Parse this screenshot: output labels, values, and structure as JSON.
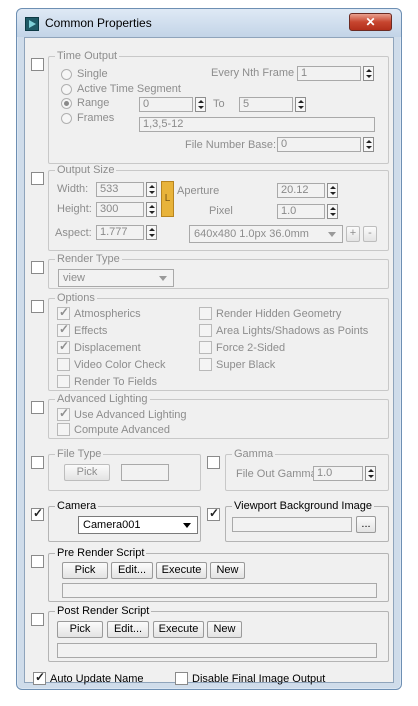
{
  "window": {
    "title": "Common Properties",
    "close_glyph": "✕"
  },
  "time_output": {
    "legend": "Time Output",
    "single": "Single",
    "every_nth_label": "Every Nth Frame",
    "every_nth_value": "1",
    "active_segment": "Active Time Segment",
    "range": "Range",
    "range_from": "0",
    "range_to_label": "To",
    "range_to": "5",
    "frames": "Frames",
    "frames_value": "1,3,5-12",
    "file_number_base_label": "File Number Base:",
    "file_number_base_value": "0"
  },
  "output_size": {
    "legend": "Output Size",
    "width_label": "Width:",
    "width_value": "533",
    "height_label": "Height:",
    "height_value": "300",
    "lock_glyph": "L",
    "aperture_label": "Aperture",
    "aperture_value": "20.12",
    "pixel_label": "Pixel",
    "pixel_value": "1.0",
    "aspect_label": "Aspect:",
    "aspect_value": "1.777",
    "preset_value": "640x480 1.0px 36.0mm",
    "add_label": "+",
    "remove_label": "-"
  },
  "render_type": {
    "legend": "Render Type",
    "value": "view"
  },
  "options": {
    "legend": "Options",
    "atmospherics": "Atmospherics",
    "effects": "Effects",
    "displacement": "Displacement",
    "video_color_check": "Video Color Check",
    "render_to_fields": "Render To Fields",
    "render_hidden_geometry": "Render Hidden Geometry",
    "area_lights": "Area Lights/Shadows as Points",
    "force_2_sided": "Force 2-Sided",
    "super_black": "Super Black"
  },
  "advanced_lighting": {
    "legend": "Advanced Lighting",
    "use_advanced": "Use Advanced Lighting",
    "compute_advanced": "Compute Advanced"
  },
  "file_type": {
    "legend": "File Type",
    "pick_label": "Pick",
    "value": ""
  },
  "gamma": {
    "legend": "Gamma",
    "file_out_label": "File Out Gamma",
    "file_out_value": "1.0"
  },
  "camera": {
    "legend": "Camera",
    "value": "Camera001"
  },
  "viewport_bg": {
    "legend": "Viewport Background Image",
    "value": "",
    "browse_label": "..."
  },
  "pre_render": {
    "legend": "Pre Render Script",
    "pick_label": "Pick",
    "edit_label": "Edit...",
    "execute_label": "Execute",
    "new_label": "New",
    "path": ""
  },
  "post_render": {
    "legend": "Post Render Script",
    "pick_label": "Pick",
    "edit_label": "Edit...",
    "execute_label": "Execute",
    "new_label": "New",
    "path": ""
  },
  "footer": {
    "auto_update_name": "Auto Update Name",
    "disable_final_output": "Disable Final Image Output"
  }
}
